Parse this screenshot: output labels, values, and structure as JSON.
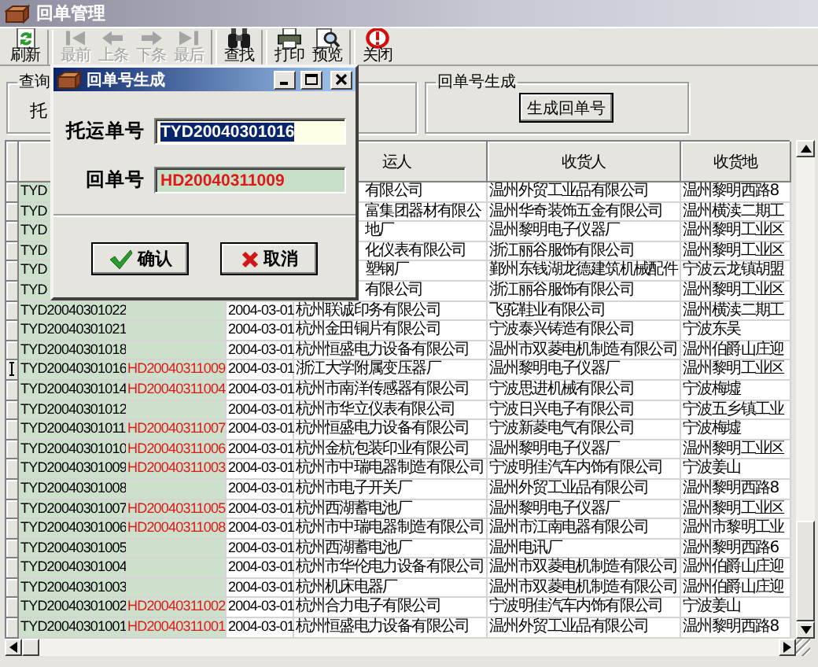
{
  "window": {
    "title": "回单管理"
  },
  "toolbar": [
    {
      "buttons": [
        {
          "label": "刷新",
          "disabled": false
        }
      ]
    },
    {
      "buttons": [
        {
          "label": "最前",
          "disabled": true
        },
        {
          "label": "上条",
          "disabled": true
        },
        {
          "label": "下条",
          "disabled": true
        },
        {
          "label": "最后",
          "disabled": true
        }
      ]
    },
    {
      "buttons": [
        {
          "label": "查找",
          "disabled": false
        }
      ]
    },
    {
      "buttons": [
        {
          "label": "打印",
          "disabled": false
        },
        {
          "label": "预览",
          "disabled": false
        }
      ]
    },
    {
      "buttons": [
        {
          "label": "关闭",
          "disabled": false
        }
      ]
    }
  ],
  "query_group": {
    "title": "查询",
    "label": "托"
  },
  "generate_group": {
    "title": "回单号生成",
    "button": "生成回单号"
  },
  "table": {
    "columns": [
      {
        "label": "运人"
      },
      {
        "label": "收货人"
      },
      {
        "label": "收货地"
      }
    ],
    "rows": [
      {
        "kind": "partial",
        "current": false,
        "shipment_no": "TYD",
        "shipper": "有限公司",
        "consignee": "温州外贸工业品有限公司",
        "address": "温州黎明西路8"
      },
      {
        "kind": "partial",
        "current": false,
        "shipment_no": "TYD",
        "shipper": "富集团器材有限公",
        "consignee": "温州华奇装饰五金有限公司",
        "address": "温州横渎二期工"
      },
      {
        "kind": "partial",
        "current": false,
        "shipment_no": "TYD",
        "shipper": "地厂",
        "consignee": "温州黎明电子仪器厂",
        "address": "温州黎明工业区"
      },
      {
        "kind": "partial",
        "current": false,
        "shipment_no": "TYD",
        "shipper": "化仪表有限公司",
        "consignee": "浙江丽谷服饰有限公司",
        "address": "温州黎明工业区"
      },
      {
        "kind": "partial",
        "current": false,
        "shipment_no": "TYD",
        "shipper": "塑钢厂",
        "consignee": "鄞州东钱湖龙德建筑机械配件",
        "address": "宁波云龙镇胡盟"
      },
      {
        "kind": "partial",
        "current": false,
        "shipment_no": "TYD",
        "shipper": "有限公司",
        "consignee": "浙江丽谷服饰有限公司",
        "address": "温州黎明工业区"
      },
      {
        "kind": "full",
        "current": false,
        "shipment_no": "TYD20040301022",
        "date": "2004-03-01",
        "shipper": "杭州联诚印务有限公司",
        "consignee": "飞驼鞋业有限公司",
        "address": "温州横渎二期工"
      },
      {
        "kind": "full",
        "current": false,
        "shipment_no": "TYD20040301021",
        "date": "2004-03-01",
        "shipper": "杭州金田铜片有限公司",
        "consignee": "宁波泰兴铸造有限公司",
        "address": "宁波东吴"
      },
      {
        "kind": "full",
        "current": false,
        "shipment_no": "TYD20040301018",
        "date": "2004-03-01",
        "shipper": "杭州恒盛电力设备有限公司",
        "consignee": "温州市双菱电机制造有限公司",
        "address": "温州伯爵山庄迎"
      },
      {
        "kind": "full",
        "current": true,
        "shipment_no": "TYD20040301016",
        "receipt_no": "HD20040311009",
        "date": "2004-03-01",
        "shipper": "浙江大学附属变压器厂",
        "consignee": "温州黎明电子仪器厂",
        "address": "温州黎明工业区"
      },
      {
        "kind": "full",
        "current": false,
        "shipment_no": "TYD20040301014",
        "receipt_no": "HD20040311004",
        "date": "2004-03-01",
        "shipper": "杭州市南洋传感器有限公司",
        "consignee": "宁波思进机械有限公司",
        "address": "宁波梅墟"
      },
      {
        "kind": "full",
        "current": false,
        "shipment_no": "TYD20040301012",
        "date": "2004-03-01",
        "shipper": "杭州市华立仪表有限公司",
        "consignee": "宁波日兴电子有限公司",
        "address": "宁波五乡镇工业"
      },
      {
        "kind": "full",
        "current": false,
        "shipment_no": "TYD20040301011",
        "receipt_no": "HD20040311007",
        "date": "2004-03-01",
        "shipper": "杭州恒盛电力设备有限公司",
        "consignee": "宁波新菱电气有限公司",
        "address": "宁波梅墟"
      },
      {
        "kind": "full",
        "current": false,
        "shipment_no": "TYD20040301010",
        "receipt_no": "HD20040311006",
        "date": "2004-03-01",
        "shipper": "杭州金杭包装印业有限公司",
        "consignee": "温州黎明电子仪器厂",
        "address": "温州黎明工业区"
      },
      {
        "kind": "full",
        "current": false,
        "shipment_no": "TYD20040301009",
        "receipt_no": "HD20040311003",
        "date": "2004-03-01",
        "shipper": "杭州市中瑞电器制造有限公司",
        "consignee": "宁波明佳汽车内饰有限公司",
        "address": "宁波姜山"
      },
      {
        "kind": "full",
        "current": false,
        "shipment_no": "TYD20040301008",
        "date": "2004-03-01",
        "shipper": "杭州市电子开关厂",
        "consignee": "温州外贸工业品有限公司",
        "address": "温州黎明西路8"
      },
      {
        "kind": "full",
        "current": false,
        "shipment_no": "TYD20040301007",
        "receipt_no": "HD20040311005",
        "date": "2004-03-01",
        "shipper": "杭州西湖蓄电池厂",
        "consignee": "温州黎明电子仪器厂",
        "address": "温州黎明工业区"
      },
      {
        "kind": "full",
        "current": false,
        "shipment_no": "TYD20040301006",
        "receipt_no": "HD20040311008",
        "date": "2004-03-01",
        "shipper": "杭州市中瑞电器制造有限公司",
        "consignee": "温州市江南电器有限公司",
        "address": "温州市黎明工业"
      },
      {
        "kind": "full",
        "current": false,
        "shipment_no": "TYD20040301005",
        "date": "2004-03-01",
        "shipper": "杭州西湖蓄电池厂",
        "consignee": "温州电讯厂",
        "address": "温州黎明西路6"
      },
      {
        "kind": "full",
        "current": false,
        "shipment_no": "TYD20040301004",
        "date": "2004-03-01",
        "shipper": "杭州市华伦电力设备有限公司",
        "consignee": "温州市双菱电机制造有限公司",
        "address": "温州伯爵山庄迎"
      },
      {
        "kind": "full",
        "current": false,
        "shipment_no": "TYD20040301003",
        "date": "2004-03-01",
        "shipper": "杭州机床电器厂",
        "consignee": "温州市双菱电机制造有限公司",
        "address": "温州伯爵山庄迎"
      },
      {
        "kind": "full",
        "current": false,
        "shipment_no": "TYD20040301002",
        "receipt_no": "HD20040311002",
        "date": "2004-03-01",
        "shipper": "杭州合力电子有限公司",
        "consignee": "宁波明佳汽车内饰有限公司",
        "address": "宁波姜山"
      },
      {
        "kind": "full",
        "current": false,
        "shipment_no": "TYD20040301001",
        "receipt_no": "HD20040311001",
        "date": "2004-03-01",
        "shipper": "杭州恒盛电力设备有限公司",
        "consignee": "温州外贸工业品有限公司",
        "address": "温州黎明西路8"
      }
    ]
  },
  "dialog": {
    "title": "回单号生成",
    "fields": [
      {
        "kind": "plain",
        "label": "托运单号",
        "value": "TYD20040301016",
        "selected": true
      },
      {
        "kind": "generated",
        "label": "回单号",
        "value": "HD20040311009",
        "selected": false
      }
    ],
    "buttons": [
      {
        "kind": "ok",
        "label": "确认"
      },
      {
        "kind": "cancel",
        "label": "取消"
      }
    ]
  }
}
